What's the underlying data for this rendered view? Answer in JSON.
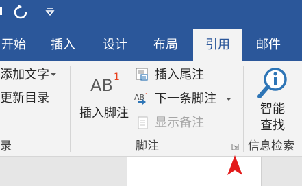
{
  "tabs": [
    {
      "label": "开始"
    },
    {
      "label": "插入"
    },
    {
      "label": "设计"
    },
    {
      "label": "布局"
    },
    {
      "label": "引用",
      "active": true
    },
    {
      "label": "邮件"
    }
  ],
  "ribbon": {
    "toc_group": {
      "add_text": "添加文字",
      "update_toc": "更新目录",
      "group_label": "录"
    },
    "footnotes_group": {
      "insert_footnote": "插入脚注",
      "insert_endnote": "插入尾注",
      "next_footnote": "下一条脚注",
      "show_notes": "显示备注",
      "group_label": "脚注",
      "ab_icon_text": "AB",
      "ab_superscript": "1"
    },
    "research_group": {
      "smart_lookup_line1": "智能",
      "smart_lookup_line2": "查找",
      "group_label": "信息检索"
    }
  },
  "colors": {
    "ribbon_blue": "#2b579a",
    "ribbon_bg": "#f3f3f3",
    "accent_red": "#e8401c",
    "cursor_red": "#e31b1b",
    "icon_blue": "#2e75b6"
  }
}
